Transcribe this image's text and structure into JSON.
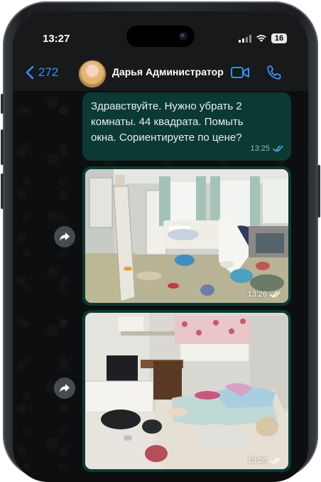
{
  "status_bar": {
    "time": "13:27",
    "battery": "16"
  },
  "header": {
    "back_count": "272",
    "contact_name": "Дарья Администратор",
    "icons": [
      "video-call-icon",
      "phone-call-icon"
    ]
  },
  "messages": [
    {
      "type": "text",
      "text_lines": [
        "Здравствуйте. Нужно убрать 2",
        "комнаты. 44 квадрата. Помыть",
        "окна. Сориентируете по цене?"
      ],
      "time": "13:25",
      "status": "read"
    },
    {
      "type": "photo",
      "description": "messy bedroom",
      "time": "13:26",
      "status": "read"
    },
    {
      "type": "photo",
      "description": "messy bedroom with pink curtains",
      "time": "13:26",
      "status": "read"
    }
  ],
  "colors": {
    "accent": "#3a8ef0",
    "outgoing_bubble": "#0b3a33",
    "read_ticks": "#4fb3f6"
  }
}
